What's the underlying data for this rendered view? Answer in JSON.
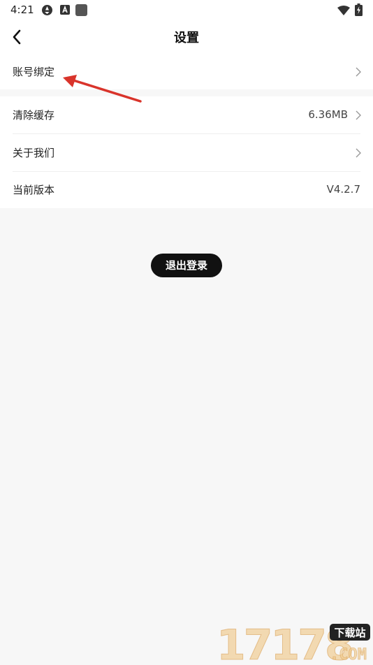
{
  "status_bar": {
    "time": "4:21"
  },
  "header": {
    "title": "设置"
  },
  "settings": {
    "account_binding": {
      "label": "账号绑定"
    },
    "clear_cache": {
      "label": "清除缓存",
      "value": "6.36MB"
    },
    "about_us": {
      "label": "关于我们"
    },
    "current_version": {
      "label": "当前版本",
      "value": "V4.2.7"
    }
  },
  "logout_label": "退出登录",
  "watermark": {
    "brand": "17178",
    "tag": "下载站",
    "suffix": ".COM"
  },
  "colors": {
    "annotation_arrow": "#d9342b",
    "button_bg": "#111111"
  }
}
